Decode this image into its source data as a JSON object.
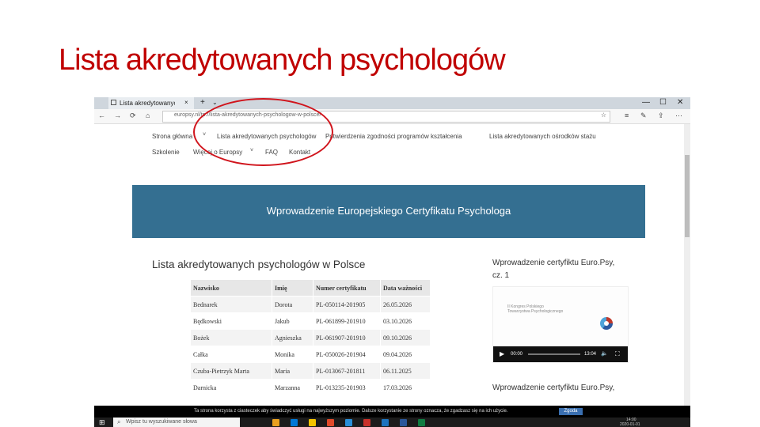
{
  "slide": {
    "title": "Lista akredytowanych psychologów"
  },
  "browser": {
    "tab_title": "Lista akredytowanych ps",
    "tab_close": "×",
    "new_tab": "+",
    "tab_menu": "⌄",
    "window_controls": [
      "—",
      "☐",
      "✕"
    ],
    "nav_buttons": [
      "←",
      "→",
      "⟳",
      "⌂"
    ],
    "url": "europsy.nl/tp://lista-akredytowanych-psychologow-w-polsce/",
    "toolbar_icons": [
      "☆",
      "≡",
      "✎",
      "⇪",
      "⋯"
    ]
  },
  "site": {
    "nav_row1": [
      {
        "label": "Strona główna",
        "dropdown": true
      },
      {
        "label": "Lista akredytowanych psychologów",
        "dropdown": false
      },
      {
        "label": "Potwierdzenia zgodności programów kształcenia",
        "dropdown": false
      },
      {
        "label": "Lista akredytowanych ośrodków stażu",
        "dropdown": false
      }
    ],
    "nav_row2": [
      {
        "label": "Szkolenie",
        "dropdown": false
      },
      {
        "label": "Więcej o Europsy",
        "dropdown": true
      },
      {
        "label": "FAQ",
        "dropdown": false
      },
      {
        "label": "Kontakt",
        "dropdown": false
      }
    ],
    "banner": "Wprowadzenie Europejskiego Certyfikatu Psychologa",
    "list_heading": "Lista akredytowanych psychologów w Polsce",
    "table": {
      "headers": [
        "Nazwisko",
        "Imię",
        "Numer certyfikatu",
        "Data ważności"
      ],
      "rows": [
        [
          "Bednarek",
          "Dorota",
          "PL-050114-201905",
          "26.05.2026"
        ],
        [
          "Będkowski",
          "Jakub",
          "PL-061899-201910",
          "03.10.2026"
        ],
        [
          "Bożek",
          "Agnieszka",
          "PL-061907-201910",
          "09.10.2026"
        ],
        [
          "Całka",
          "Monika",
          "PL-050026-201904",
          "09.04.2026"
        ],
        [
          "Czuba-Pietrzyk Marta",
          "Maria",
          "PL-013067-201811",
          "06.11.2025"
        ],
        [
          "Darnicka",
          "Marzanna",
          "PL-013235-201903",
          "17.03.2026"
        ]
      ]
    },
    "sidebar": {
      "video1_title_line1": "Wprowadzenie certyfiktu Euro.Psy,",
      "video1_title_line2": "cz. 1",
      "video_logo_text_line1": "II Kongres Polskiego",
      "video_logo_text_line2": "Towarzystwa Psychologicznego",
      "video_time_current": "00:00",
      "video_time_total": "13:04",
      "video_play": "▶",
      "video_volume": "🔈",
      "video_fullscreen": "⛶",
      "video2_title": "Wprowadzenie certyfiktu Euro.Psy,"
    },
    "cookie": {
      "text": "Ta strona korzysta z ciasteczek aby świadczyć usługi na najwyższym poziomie. Dalsze korzystanie ze strony oznacza, że zgadzasz się na ich użycie.",
      "button": "Zgoda"
    }
  },
  "taskbar": {
    "search_placeholder": "Wpisz tu wyszukiwane słowa",
    "time": "14:00",
    "date": "2020-01-01",
    "app_icon_colors": [
      "#e8a020",
      "#0078d7",
      "#f5c400",
      "#e04a2a",
      "#2a8fd8",
      "#c8312a",
      "#1e73be",
      "#2b579a",
      "#107c41"
    ]
  }
}
